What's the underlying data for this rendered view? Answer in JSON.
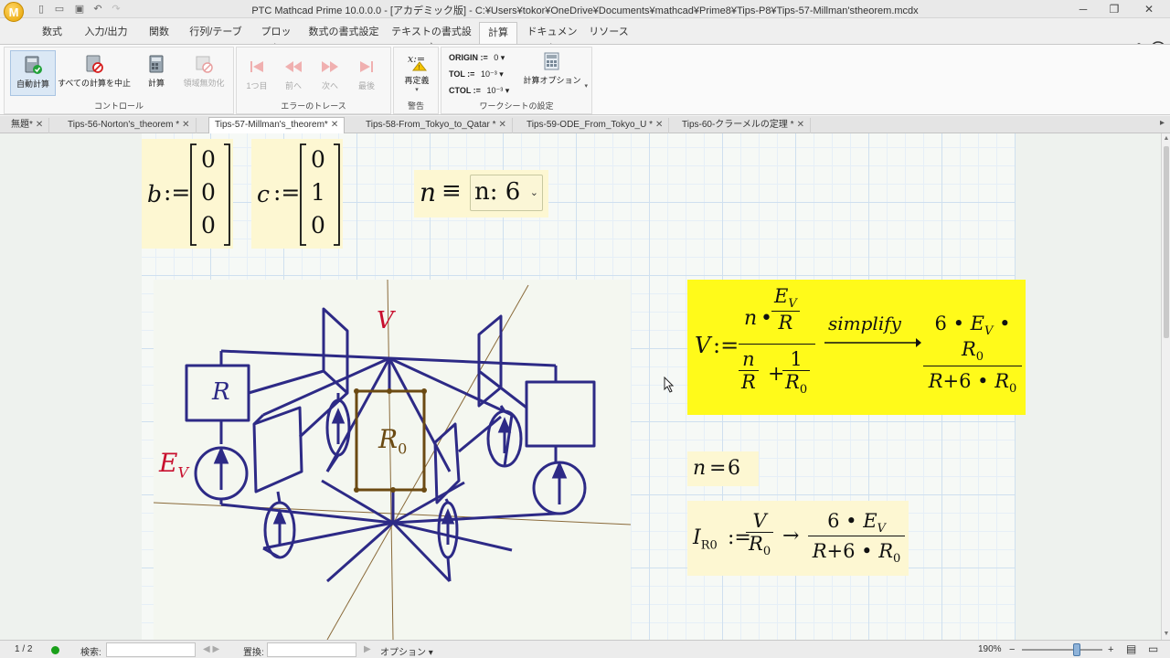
{
  "window": {
    "title": "PTC Mathcad Prime 10.0.0.0 - [アカデミック版] - C:¥Users¥tokor¥OneDrive¥Documents¥mathcad¥Prime8¥Tips-P8¥Tips-57-Millman'stheorem.mcdx",
    "logo_letter": "M"
  },
  "ribbon_tabs": [
    "数式",
    "入力/出力",
    "関数",
    "行列/テーブル",
    "プロット",
    "数式の書式設定",
    "テキストの書式設定",
    "計算",
    "ドキュメント",
    "リソース"
  ],
  "ribbon": {
    "groups": {
      "control": "コントロール",
      "error_trace": "エラーのトレース",
      "warning": "警告",
      "worksheet_settings": "ワークシートの設定"
    },
    "buttons": {
      "auto_calc": "自動計算",
      "stop_all": "すべての計算を中止",
      "calc": "計算",
      "disable_region": "領域無効化",
      "first": "1つ目",
      "prev": "前へ",
      "next": "次へ",
      "last": "最後",
      "redefine": "再定義",
      "calc_options": "計算オプション"
    },
    "worksheet": {
      "origin_label": "ORIGIN :=",
      "origin_value": "0",
      "tol_label": "TOL :=",
      "tol_value": "10⁻³",
      "ctol_label": "CTOL :=",
      "ctol_value": "10⁻³"
    }
  },
  "doc_tabs": [
    {
      "label": "無題*",
      "active": false
    },
    {
      "label": "Tips-56-Norton's_theorem *",
      "active": false
    },
    {
      "label": "Tips-57-Millman's_theorem*",
      "active": true
    },
    {
      "label": "Tips-58-From_Tokyo_to_Qatar *",
      "active": false
    },
    {
      "label": "Tips-59-ODE_From_Tokyo_U *",
      "active": false
    },
    {
      "label": "Tips-60-クラーメルの定理 *",
      "active": false
    }
  ],
  "math": {
    "b_var": "b",
    "b_vec": [
      "0",
      "0",
      "0"
    ],
    "c_var": "c",
    "c_vec": [
      "0",
      "1",
      "0"
    ],
    "n_var": "n",
    "n_combo": "n: 6",
    "v_var": "V",
    "simplify": "simplify",
    "n_result_lhs": "n",
    "n_result_rhs": "6",
    "current_var": "I",
    "current_sub": "R0"
  },
  "diagram": {
    "v_label": "V",
    "r_label": "R",
    "r0_label": "R",
    "r0_sub": "0",
    "ev_label": "E",
    "ev_sub": "V"
  },
  "statusbar": {
    "page": "1 / 2",
    "search_label": "検索:",
    "replace_label": "置換:",
    "options_label": "オプション",
    "zoom": "190%"
  },
  "colors": {
    "highlight_yellow": "#fffa1a",
    "region_cream": "#fdf7d2",
    "circuit_blue": "#2d2a86",
    "r0_brown": "#6b4a12",
    "label_red": "#c8102e"
  }
}
